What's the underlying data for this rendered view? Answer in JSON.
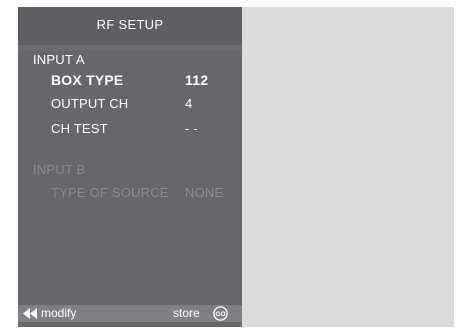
{
  "menu": {
    "title": "RF  SETUP",
    "input_a": {
      "label": "INPUT A",
      "box_type": {
        "label": "BOX TYPE",
        "value": "112"
      },
      "output_ch": {
        "label": "OUTPUT CH",
        "value": "4"
      },
      "ch_test": {
        "label": "CH  TEST",
        "value": "- -"
      }
    },
    "input_b": {
      "label": "INPUT  B",
      "type_of_source": {
        "label": "TYPE  OF  SOURCE",
        "value": "NONE"
      }
    }
  },
  "footer": {
    "rewind_icon": "rewind-icon",
    "modify_label": "modify",
    "store_label": "store",
    "go_icon": "GO"
  },
  "colors": {
    "panel": "#66676b",
    "screen": "#dcdcdd",
    "footer_bar": "#7f8084",
    "dim_text": "#8b8c90"
  }
}
